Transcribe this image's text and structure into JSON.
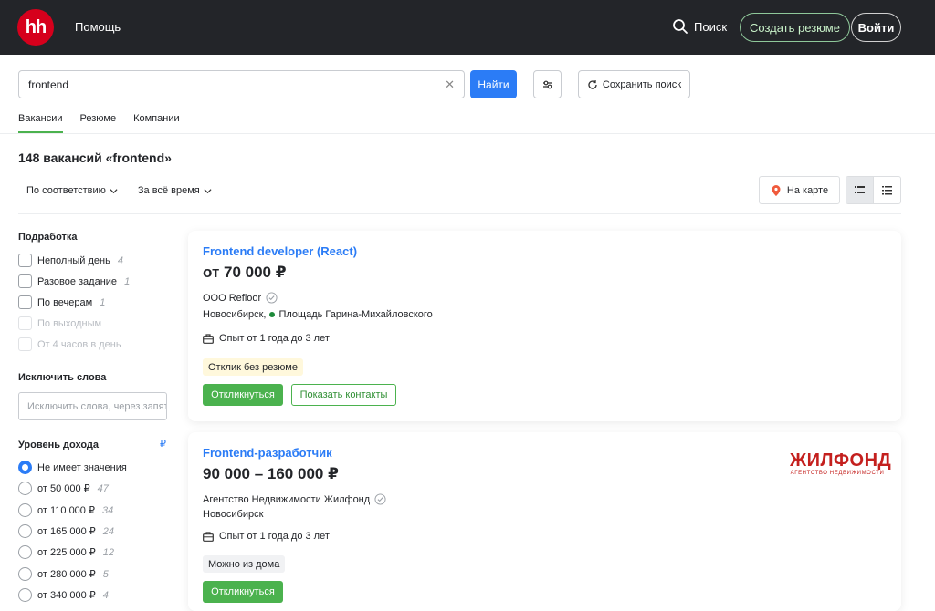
{
  "header": {
    "logo_text": "hh",
    "help": "Помощь",
    "search": "Поиск",
    "create_resume": "Создать резюме",
    "login": "Войти"
  },
  "search": {
    "value": "frontend",
    "find_button": "Найти",
    "save_search": "Сохранить поиск"
  },
  "tabs": [
    "Вакансии",
    "Резюме",
    "Компании"
  ],
  "results_title": "148 вакансий «frontend»",
  "sort": {
    "relevance": "По соответствию",
    "period": "За всё время"
  },
  "map_button": "На карте",
  "sidebar": {
    "parttime_heading": "Подработка",
    "parttime": [
      {
        "label": "Неполный день",
        "count": "4",
        "disabled": false
      },
      {
        "label": "Разовое задание",
        "count": "1",
        "disabled": false
      },
      {
        "label": "По вечерам",
        "count": "1",
        "disabled": false
      },
      {
        "label": "По выходным",
        "count": "",
        "disabled": true
      },
      {
        "label": "От 4 часов в день",
        "count": "",
        "disabled": true
      }
    ],
    "exclude_heading": "Исключить слова",
    "exclude_placeholder": "Исключить слова, через запятую",
    "income_heading": "Уровень дохода",
    "currency": "₽",
    "income": [
      {
        "label": "Не имеет значения",
        "count": "",
        "selected": true
      },
      {
        "label": "от 50 000 ₽",
        "count": "47",
        "selected": false
      },
      {
        "label": "от 110 000 ₽",
        "count": "34",
        "selected": false
      },
      {
        "label": "от 165 000 ₽",
        "count": "24",
        "selected": false
      },
      {
        "label": "от 225 000 ₽",
        "count": "12",
        "selected": false
      },
      {
        "label": "от 280 000 ₽",
        "count": "5",
        "selected": false
      },
      {
        "label": "от 340 000 ₽",
        "count": "4",
        "selected": false
      }
    ]
  },
  "vacancies": [
    {
      "title": "Frontend developer (React)",
      "salary": "от 70 000 ₽",
      "company": "ООО Refloor",
      "city": "Новосибирск,",
      "metro": "Площадь Гарина-Михайловского",
      "experience": "Опыт от 1 года до 3 лет",
      "tag": "Отклик без резюме",
      "apply": "Откликнуться",
      "contacts": "Показать контакты"
    },
    {
      "title": "Frontend-разработчик",
      "salary": "90 000 – 160 000 ₽",
      "company": "Агентство Недвижимости Жилфонд",
      "city": "Новосибирск",
      "experience": "Опыт от 1 года до 3 лет",
      "tag": "Можно из дома",
      "apply": "Откликнуться",
      "logo_big": "ЖИЛФОНД",
      "logo_small": "АГЕНТСТВО НЕДВИЖИМОСТИ"
    }
  ],
  "colors": {
    "header_bg": "#232529",
    "brand_red": "#d6001c",
    "link_blue": "#2b7cf6",
    "green": "#4bb24e"
  }
}
